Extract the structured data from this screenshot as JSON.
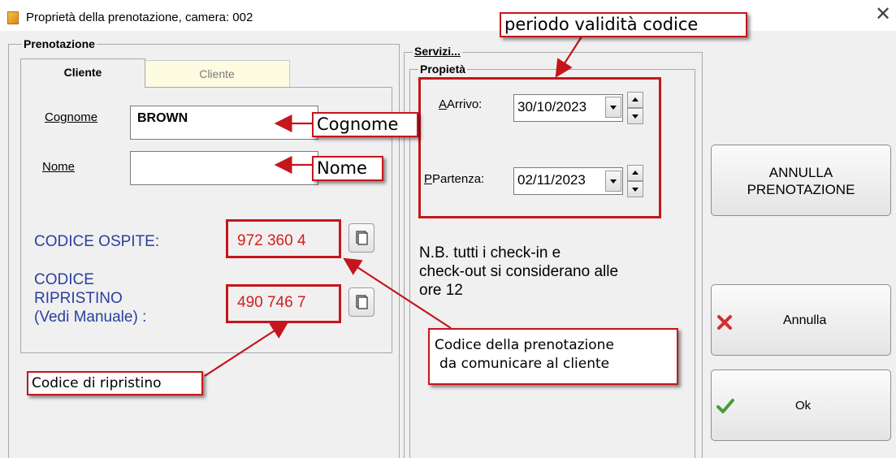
{
  "window": {
    "title": "Proprietà della prenotazione, camera: 002",
    "close_glyph": "✕"
  },
  "prenotazione": {
    "group_label": "Prenotazione",
    "tabs": [
      "Cliente",
      "Cliente"
    ],
    "cognome_label": "Cognome",
    "cognome_value": "BROWN",
    "nome_label": "Nome",
    "nome_value": "",
    "codice_ospite_label": "CODICE OSPITE:",
    "codice_ospite_value": "972 360 4",
    "codice_ripristino_label": [
      "CODICE",
      "RIPRISTINO",
      "(Vedi Manuale) :"
    ],
    "codice_ripristino_value": "490 746 7"
  },
  "servizi": {
    "group_label": "Servizi...",
    "propieta_label": "Propietà",
    "arrivo_label": "Arrivo:",
    "arrivo_value": "30/10/2023",
    "partenza_label": "Partenza:",
    "partenza_value": "02/11/2023",
    "note": [
      "N.B. tutti i check-in e",
      "check-out si considerano alle",
      "ore 12"
    ]
  },
  "buttons": {
    "annulla_prenotazione": [
      "ANNULLA",
      "PRENOTAZIONE"
    ],
    "annulla": "Annulla",
    "ok": "Ok"
  },
  "callouts": {
    "periodo": "periodo validità codice",
    "cognome": "Cognome",
    "nome": "Nome",
    "codice_prenotazione": [
      "Codice della prenotazione",
      "da comunicare al cliente"
    ],
    "codice_ripristino": "Codice di ripristino"
  },
  "colors": {
    "annotation_red": "#c4161c",
    "code_blue": "#2a3f9e",
    "code_red": "#d02020"
  }
}
